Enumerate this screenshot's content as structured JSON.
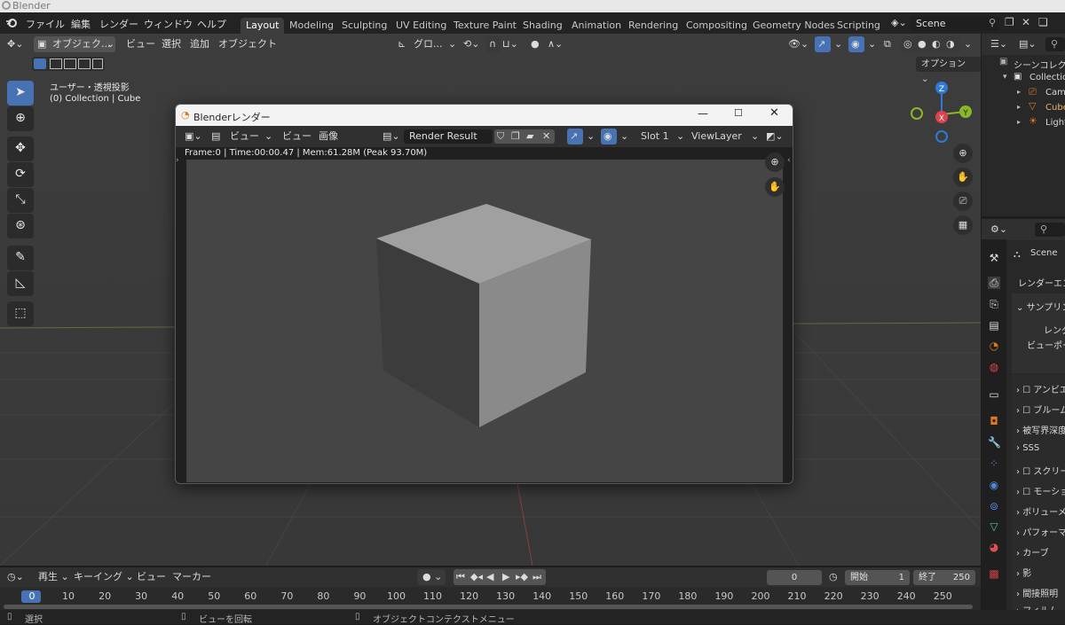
{
  "os_title": "Blender",
  "menu": [
    "ファイル",
    "編集",
    "レンダー",
    "ウィンドウ",
    "ヘルプ"
  ],
  "workspaces": [
    "Layout",
    "Modeling",
    "Sculpting",
    "UV Editing",
    "Texture Paint",
    "Shading",
    "Animation",
    "Rendering",
    "Compositing",
    "Geometry Nodes",
    "Scripting"
  ],
  "active_workspace": "Layout",
  "scene_name": "Scene",
  "viewport": {
    "mode": "オブジェク...",
    "menus": [
      "ビュー",
      "選択",
      "追加",
      "オブジェクト"
    ],
    "transform": "グロ...",
    "options_label": "オプション",
    "overlay_line1": "ユーザー・透視投影",
    "overlay_line2": "(0) Collection | Cube",
    "gizmo_axes": [
      "Z",
      "X",
      "Y"
    ]
  },
  "render_window": {
    "title": "Blenderレンダー",
    "view_menu1": "ビュー",
    "view_menu2": "ビュー",
    "image_menu": "画像",
    "image_name": "Render Result",
    "slot": "Slot 1",
    "view_layer": "ViewLayer",
    "stats": "Frame:0 | Time:00:00.47 | Mem:61.28M (Peak 93.70M)"
  },
  "outliner": {
    "header": "シーンコレク",
    "collection": "Collection",
    "items": [
      "Cam",
      "Cube",
      "Light"
    ]
  },
  "properties": {
    "scene": "Scene",
    "render_engine_label": "レンダーエン",
    "sampling": "サンプリン",
    "render_sub": "レンダ",
    "viewport_sub": "ビューポー",
    "sections": [
      "アンビエ",
      "ブルーム",
      "被写界深度",
      "SSS",
      "スクリー",
      "モーショ",
      "ボリューメ",
      "パフォーマ",
      "カーブ",
      "影",
      "間接照明",
      "フィルム"
    ]
  },
  "timeline": {
    "menus": [
      "再生",
      "キーイング",
      "ビュー",
      "マーカー"
    ],
    "current_frame": "0",
    "start_label": "開始",
    "start_value": "1",
    "end_label": "終了",
    "end_value": "250",
    "ticks": [
      "0",
      "10",
      "20",
      "30",
      "40",
      "50",
      "60",
      "70",
      "80",
      "90",
      "100",
      "110",
      "120",
      "130",
      "140",
      "150",
      "160",
      "170",
      "180",
      "190",
      "200",
      "210",
      "220",
      "230",
      "240",
      "250"
    ]
  },
  "status": {
    "select": "選択",
    "rotate": "ビューを回転",
    "context": "オブジェクトコンテクストメニュー"
  },
  "colors": {
    "accent": "#4772b3",
    "axis_x": "#e04050",
    "axis_y": "#8ab825",
    "axis_z": "#2f7ad6"
  }
}
